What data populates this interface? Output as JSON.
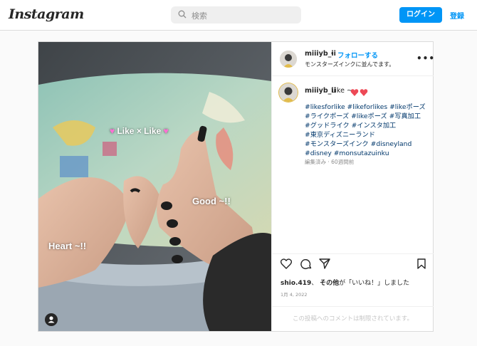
{
  "nav": {
    "logo": "Instagram",
    "search_placeholder": "検索",
    "login_label": "ログイン",
    "register_label": "登録"
  },
  "post": {
    "username": "miiiyb_ii",
    "separator": "•",
    "follow_label": "フォローする",
    "location": "モンスターズインクに並んでます。",
    "more_label": "•••",
    "photo_overlay": {
      "like_text": "Like × Like",
      "good_text": "Good ~!!",
      "heart_text": "Heart ~!!"
    },
    "caption": {
      "username": "miiiyb_ii",
      "text": "Like ~",
      "hashtags": [
        "#likesforlike",
        "#likeforlikes",
        "#likeポーズ",
        "#ライクポーズ",
        "#likeポーズ",
        "#写真加工",
        "#グッドライク",
        "#インスタ加工",
        "#東京ディズニーランド",
        "#モンスターズインク",
        "#disneyland",
        "#disney",
        "#monsutazuinku"
      ],
      "meta": "編集済み · 60週間前"
    },
    "likes": {
      "user": "shio.419",
      "others": "その他",
      "suffix": "が「いいね！」しました"
    },
    "date": "1月 4, 2022",
    "comment_disabled": "この投稿へのコメントは制限されています。"
  },
  "colors": {
    "brand_blue": "#0095f6",
    "heart_red": "#ed4956",
    "border": "#dbdbdb"
  }
}
